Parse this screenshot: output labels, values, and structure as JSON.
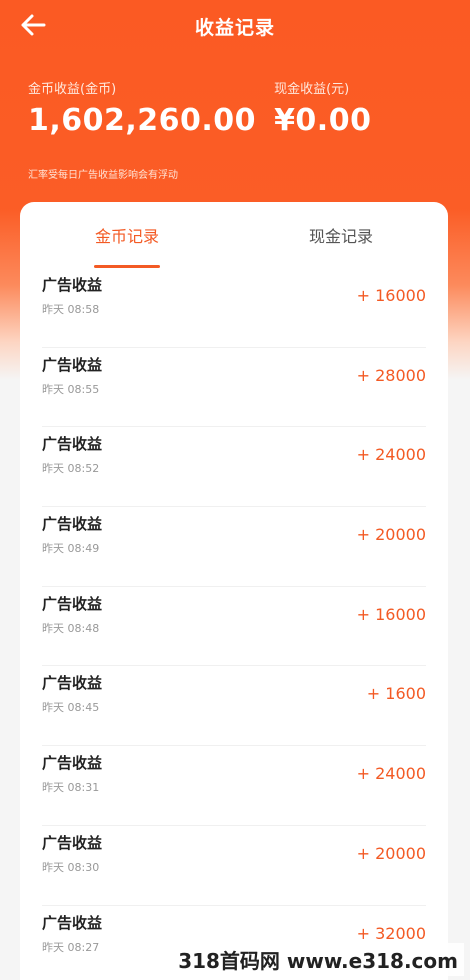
{
  "header": {
    "title": "收益记录"
  },
  "stats": {
    "coin": {
      "label": "金币收益(金币)",
      "value": "1,602,260.00"
    },
    "cash": {
      "label": "现金收益(元)",
      "value": "¥0.00"
    }
  },
  "note": "汇率受每日广告收益影响会有浮动",
  "tabs": [
    {
      "label": "金币记录"
    },
    {
      "label": "现金记录"
    }
  ],
  "records": [
    {
      "title": "广告收益",
      "time": "昨天 08:58",
      "amount": "+ 16000"
    },
    {
      "title": "广告收益",
      "time": "昨天 08:55",
      "amount": "+ 28000"
    },
    {
      "title": "广告收益",
      "time": "昨天 08:52",
      "amount": "+ 24000"
    },
    {
      "title": "广告收益",
      "time": "昨天 08:49",
      "amount": "+ 20000"
    },
    {
      "title": "广告收益",
      "time": "昨天 08:48",
      "amount": "+ 16000"
    },
    {
      "title": "广告收益",
      "time": "昨天 08:45",
      "amount": "+ 1600"
    },
    {
      "title": "广告收益",
      "time": "昨天 08:31",
      "amount": "+ 24000"
    },
    {
      "title": "广告收益",
      "time": "昨天 08:30",
      "amount": "+ 20000"
    },
    {
      "title": "广告收益",
      "time": "昨天 08:27",
      "amount": "+ 32000"
    }
  ],
  "watermark": "318首码网 www.e318.com",
  "colors": {
    "accent": "#f35a24",
    "header": "#fb5a23"
  }
}
